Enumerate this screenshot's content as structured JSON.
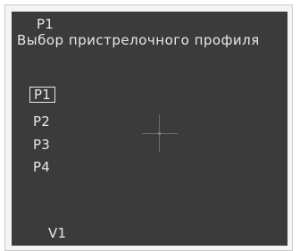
{
  "header": {
    "profile_indicator": "P1",
    "title": "Выбор пристрелочного профиля"
  },
  "menu": {
    "items": [
      {
        "label": "P1",
        "selected": true
      },
      {
        "label": "P2",
        "selected": false
      },
      {
        "label": "P3",
        "selected": false
      },
      {
        "label": "P4",
        "selected": false
      }
    ]
  },
  "footer": {
    "version": "V1"
  },
  "colors": {
    "screen_background": "#3b3b3b",
    "text": "#e8e8e8",
    "crosshair": "#6b6b6b"
  },
  "icons": {
    "center": "crosshair-icon"
  }
}
